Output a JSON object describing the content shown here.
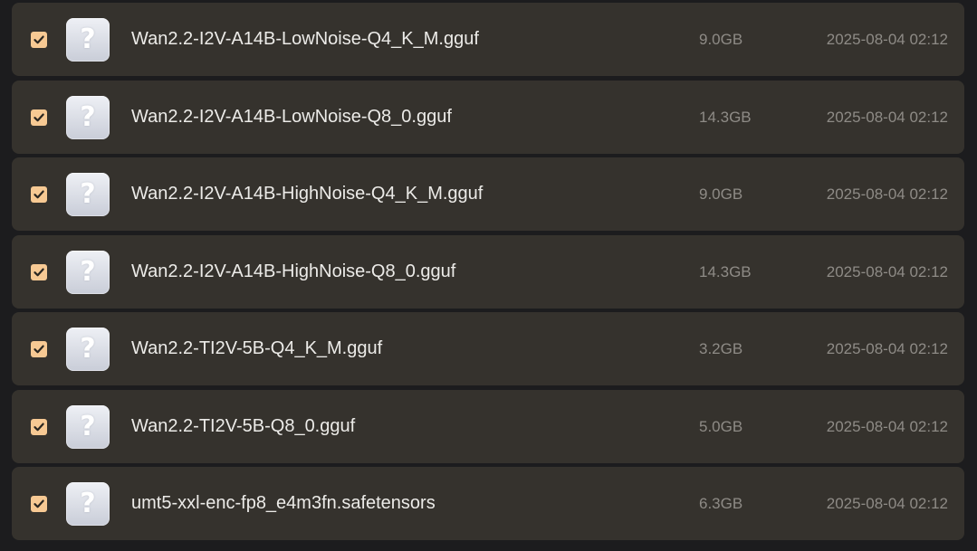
{
  "colors": {
    "page_background": "#1c1c1e",
    "row_background": "#35322d",
    "checkbox_fill": "#f7c993",
    "checkmark": "#2a2620",
    "filename_text": "#ecebe8",
    "meta_text": "#8e8b86"
  },
  "icons": {
    "row_icon": "unknown-file-question-icon",
    "check": "checkmark-icon"
  },
  "files": [
    {
      "checked": true,
      "name": "Wan2.2-I2V-A14B-LowNoise-Q4_K_M.gguf",
      "size": "9.0GB",
      "date": "2025-08-04 02:12"
    },
    {
      "checked": true,
      "name": "Wan2.2-I2V-A14B-LowNoise-Q8_0.gguf",
      "size": "14.3GB",
      "date": "2025-08-04 02:12"
    },
    {
      "checked": true,
      "name": "Wan2.2-I2V-A14B-HighNoise-Q4_K_M.gguf",
      "size": "9.0GB",
      "date": "2025-08-04 02:12"
    },
    {
      "checked": true,
      "name": "Wan2.2-I2V-A14B-HighNoise-Q8_0.gguf",
      "size": "14.3GB",
      "date": "2025-08-04 02:12"
    },
    {
      "checked": true,
      "name": "Wan2.2-TI2V-5B-Q4_K_M.gguf",
      "size": "3.2GB",
      "date": "2025-08-04 02:12"
    },
    {
      "checked": true,
      "name": "Wan2.2-TI2V-5B-Q8_0.gguf",
      "size": "5.0GB",
      "date": "2025-08-04 02:12"
    },
    {
      "checked": true,
      "name": "umt5-xxl-enc-fp8_e4m3fn.safetensors",
      "size": "6.3GB",
      "date": "2025-08-04 02:12"
    }
  ]
}
